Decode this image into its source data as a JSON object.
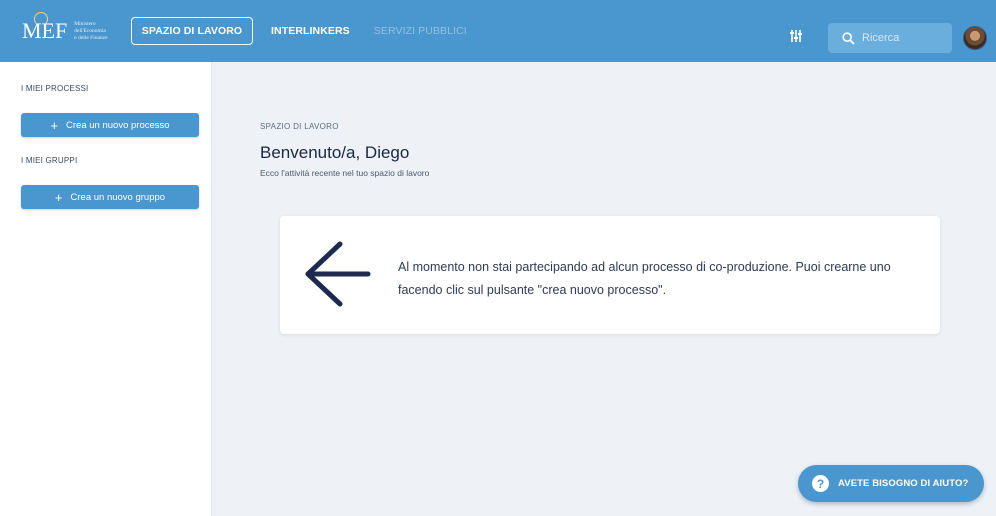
{
  "header": {
    "logo": {
      "mark": "MEF",
      "lines": [
        "Ministero",
        "dell'Economia",
        "e delle Finanze"
      ]
    },
    "nav": [
      {
        "label": "SPAZIO DI LAVORO",
        "active": true
      },
      {
        "label": "INTERLINKERS",
        "active": false
      },
      {
        "label": "SERVIZI PUBBLICI",
        "active": false
      }
    ],
    "search": {
      "placeholder": "Ricerca"
    },
    "icons": {
      "filter": "sliders-icon",
      "search": "search-icon",
      "avatar": "user-avatar"
    }
  },
  "sidebar": {
    "processes_heading": "I MIEI PROCESSI",
    "new_process_button": "Crea un nuovo processo",
    "groups_heading": "I MIEI GRUPPI",
    "new_group_button": "Crea un nuovo gruppo",
    "plus_symbol": "+"
  },
  "main": {
    "breadcrumb": "SPAZIO DI LAVORO",
    "title": "Benvenuto/a, Diego",
    "subtitle": "Ecco l'attività recente nel tuo spazio di lavoro",
    "empty_state": {
      "icon": "arrow-left-icon",
      "text": "Al momento non stai partecipando ad alcun processo di co-produzione. Puoi crearne uno facendo clic sul pulsante \"crea nuovo processo\"."
    }
  },
  "help": {
    "icon_symbol": "?",
    "label": "AVETE BISOGNO DI AIUTO?"
  },
  "colors": {
    "primary": "#4a96ce",
    "background": "#eef2f6",
    "text_dark": "#1b2742"
  }
}
